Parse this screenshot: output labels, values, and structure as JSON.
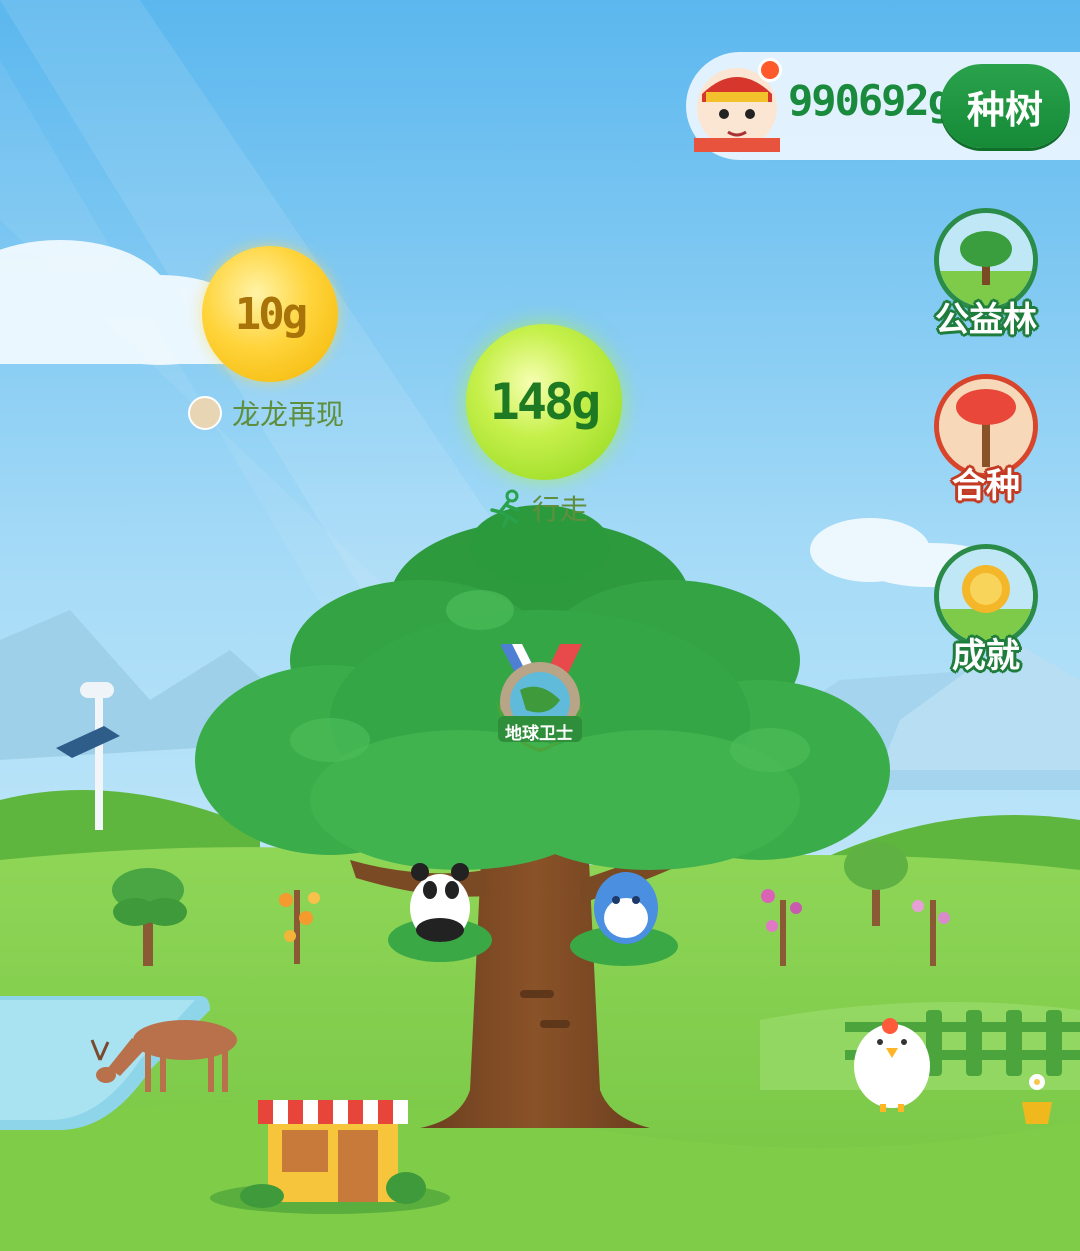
{
  "header": {
    "avatar_icon": "monkey-king-avatar",
    "energy_total": "990692g",
    "plant_button": "种树"
  },
  "side_buttons": [
    {
      "label": "公益林",
      "icon": "forest-icon"
    },
    {
      "label": "合种",
      "icon": "co-plant-tree-icon"
    },
    {
      "label": "成就",
      "icon": "achievement-icon"
    }
  ],
  "energy_bubbles": [
    {
      "value": "10g",
      "source": "龙龙再现",
      "color": "yellow"
    },
    {
      "value": "148g",
      "source": "行走",
      "color": "green"
    }
  ],
  "tree": {
    "medal_text": "地球卫士"
  },
  "colors": {
    "accent_green": "#168a37",
    "sky": "#7cc8f2",
    "grass": "#86cf4e"
  }
}
